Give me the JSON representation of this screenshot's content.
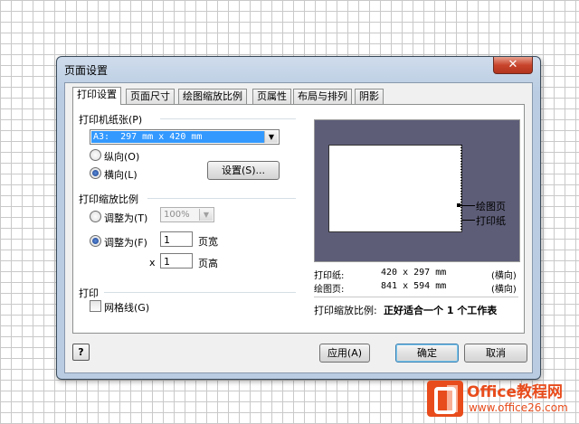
{
  "dialog": {
    "title": "页面设置",
    "close_label": "✕"
  },
  "tabs": [
    {
      "label": "打印设置",
      "active": true
    },
    {
      "label": "页面尺寸"
    },
    {
      "label": "绘图缩放比例"
    },
    {
      "label": "页属性"
    },
    {
      "label": "布局与排列"
    },
    {
      "label": "阴影"
    }
  ],
  "paper": {
    "group_label": "打印机纸张(P)",
    "selected": "A3:  297 mm x 420 mm",
    "portrait_label": "纵向(O)",
    "landscape_label": "横向(L)",
    "orientation": "landscape",
    "setup_button": "设置(S)..."
  },
  "zoom": {
    "group_label": "打印缩放比例",
    "adjust_to_label": "调整为(T)",
    "adjust_value": "100%",
    "fit_to_label": "调整为(F)",
    "fit_width": "1",
    "fit_width_label": "页宽",
    "x_label": "x",
    "fit_height": "1",
    "fit_height_label": "页高",
    "selected": "fit"
  },
  "print": {
    "group_label": "打印",
    "gridlines_label": "网格线(G)",
    "gridlines_checked": false
  },
  "preview": {
    "drawing_callout": "绘图页",
    "paper_callout": "打印纸",
    "info": [
      {
        "label": "打印纸:",
        "size": "420 x 297 mm",
        "orient": "(横向)"
      },
      {
        "label": "绘图页:",
        "size": "841 x 594 mm",
        "orient": "(横向)"
      }
    ],
    "scale_label": "打印缩放比例:",
    "scale_value": "正好适合一个 1 个工作表"
  },
  "footer": {
    "help_icon": "?",
    "apply": "应用(A)",
    "ok": "确定",
    "cancel": "取消"
  },
  "watermark": {
    "title": "Office教程网",
    "url": "www.office26.com",
    "brand_color": "#e84c1c"
  }
}
